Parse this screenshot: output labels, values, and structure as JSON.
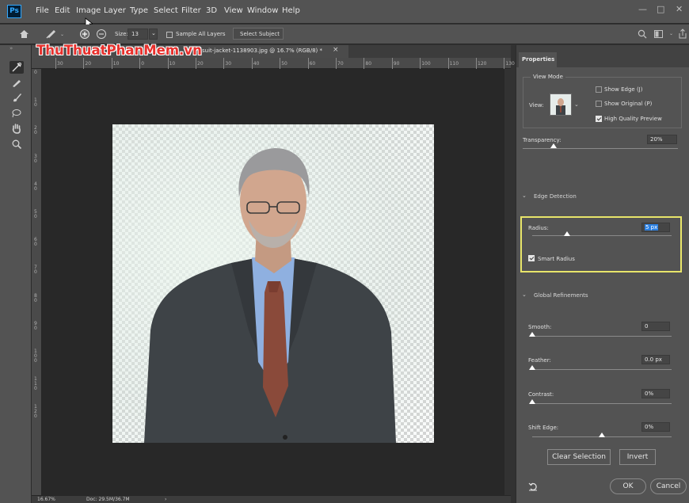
{
  "menu": {
    "app_icon": "Ps",
    "items": [
      "File",
      "Edit",
      "Image",
      "Layer",
      "Type",
      "Select",
      "Filter",
      "3D",
      "View",
      "Window",
      "Help"
    ],
    "window_controls": [
      "—",
      "□",
      "✕"
    ]
  },
  "options_bar": {
    "size_label": "Size:",
    "size_value": "13",
    "sample_all_layers_label": "Sample All Layers",
    "sample_all_layers_checked": false,
    "select_subject_label": "Select Subject"
  },
  "tab": {
    "title": "suit-jacket-1138903.jpg @ 16.7% (RGB/8) *",
    "close": "×",
    "watermark": "ThuThuatPhanMem.vn"
  },
  "ruler": {
    "top_ticks": [
      "30",
      "20",
      "10",
      "0",
      "10",
      "20",
      "30",
      "40",
      "50",
      "60",
      "70",
      "80",
      "90",
      "100",
      "110",
      "120",
      "130"
    ],
    "left_ticks": [
      "0",
      "1 0",
      "2 0",
      "3 0",
      "4 0",
      "5 0",
      "6 0",
      "7 0",
      "8 0",
      "9 0",
      "1 0 0",
      "1 1 0",
      "1 2 0"
    ]
  },
  "properties": {
    "tab_label": "Properties",
    "view_mode": {
      "title": "View Mode",
      "view_label": "View:",
      "show_edge": {
        "label": "Show Edge (J)",
        "checked": false
      },
      "show_original": {
        "label": "Show Original (P)",
        "checked": false
      },
      "high_quality": {
        "label": "High Quality Preview",
        "checked": true
      }
    },
    "transparency": {
      "label": "Transparency:",
      "value": "20%",
      "fraction": 0.2
    },
    "edge_detection": {
      "title": "Edge Detection",
      "radius": {
        "label": "Radius:",
        "value": "5 px",
        "fraction": 0.25
      },
      "smart_radius": {
        "label": "Smart Radius",
        "checked": true
      }
    },
    "global_refinements": {
      "title": "Global Refinements",
      "smooth": {
        "label": "Smooth:",
        "value": "0",
        "fraction": 0
      },
      "feather": {
        "label": "Feather:",
        "value": "0.0 px",
        "fraction": 0
      },
      "contrast": {
        "label": "Contrast:",
        "value": "0%",
        "fraction": 0
      },
      "shift_edge": {
        "label": "Shift Edge:",
        "value": "0%",
        "fraction": 0.5
      }
    },
    "clear_selection_label": "Clear Selection",
    "invert_label": "Invert",
    "ok_label": "OK",
    "cancel_label": "Cancel"
  },
  "status": {
    "zoom": "16.67%",
    "doc": "Doc: 29.5M/36.7M",
    "arrow": "›"
  },
  "colors": {
    "highlight_box": "#e8e56a",
    "radius_input_bg": "#2a7fe0"
  }
}
